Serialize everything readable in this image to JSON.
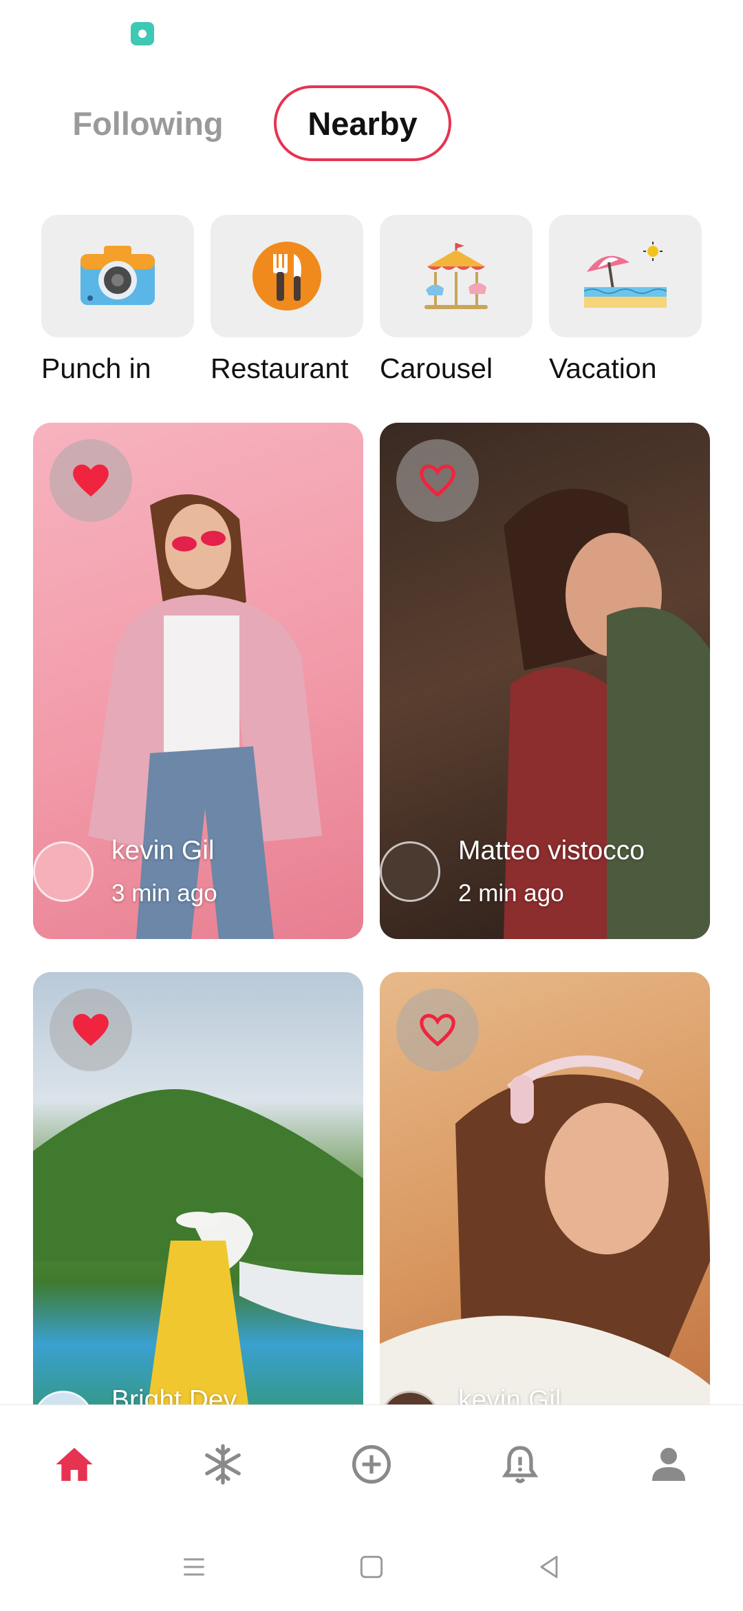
{
  "tabs": [
    {
      "label": "Following",
      "active": false
    },
    {
      "label": "Nearby",
      "active": true
    }
  ],
  "categories": [
    {
      "label": "Punch in",
      "icon": "camera-icon"
    },
    {
      "label": "Restaurant",
      "icon": "fork-knife-icon"
    },
    {
      "label": "Carousel",
      "icon": "carousel-icon"
    },
    {
      "label": "Vacation",
      "icon": "beach-umbrella-icon"
    }
  ],
  "posts": [
    {
      "name": "kevin Gil",
      "time": "3 min ago",
      "liked": true
    },
    {
      "name": "Matteo vistocco",
      "time": "2 min ago",
      "liked": false
    },
    {
      "name": "Bright Dev",
      "time": "",
      "liked": true
    },
    {
      "name": "kevin Gil",
      "time": "",
      "liked": false
    }
  ],
  "bottom_nav": [
    {
      "icon": "home-icon",
      "active": true
    },
    {
      "icon": "snowflake-icon",
      "active": false
    },
    {
      "icon": "add-circle-icon",
      "active": false
    },
    {
      "icon": "bell-icon",
      "active": false
    },
    {
      "icon": "profile-icon",
      "active": false
    }
  ],
  "colors": {
    "accent": "#e63351",
    "heart": "#f0243f",
    "inactive": "#8a8a8a"
  }
}
